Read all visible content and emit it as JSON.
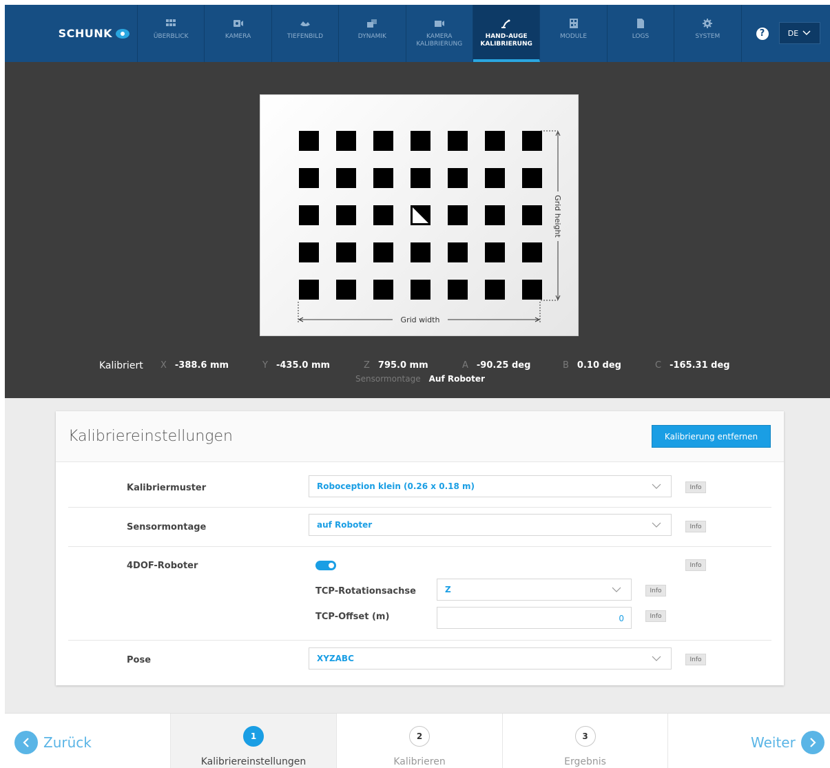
{
  "header": {
    "logo_text": "SCHUNK",
    "tabs": [
      {
        "label": "ÜBERBLICK",
        "icon": "grid-icon"
      },
      {
        "label": "KAMERA",
        "icon": "camera-icon"
      },
      {
        "label": "TIEFENBILD",
        "icon": "depth-icon"
      },
      {
        "label": "DYNAMIK",
        "icon": "dynamics-icon"
      },
      {
        "label": "KAMERA\nKALIBRIERUNG",
        "icon": "video-icon"
      },
      {
        "label": "HAND-AUGE\nKALIBRIERUNG",
        "icon": "robot-arm-icon"
      },
      {
        "label": "MODULE",
        "icon": "qr-module-icon"
      },
      {
        "label": "LOGS",
        "icon": "document-icon"
      },
      {
        "label": "SYSTEM",
        "icon": "gear-icon"
      }
    ],
    "active_tab": 5,
    "help": "?",
    "language": "DE"
  },
  "preview": {
    "grid_width_label": "Grid width",
    "grid_height_label": "Grid height",
    "calibrated_label": "Kalibriert",
    "pose": [
      {
        "key": "X",
        "value": "-388.6 mm"
      },
      {
        "key": "Y",
        "value": "-435.0 mm"
      },
      {
        "key": "Z",
        "value": "795.0 mm"
      },
      {
        "key": "A",
        "value": "-90.25 deg"
      },
      {
        "key": "B",
        "value": "0.10 deg"
      },
      {
        "key": "C",
        "value": "-165.31 deg"
      }
    ],
    "mount_key": "Sensormontage",
    "mount_value": "Auf Roboter"
  },
  "settings": {
    "title": "Kalibriereinstellungen",
    "remove_button": "Kalibrierung entfernen",
    "info_label": "Info",
    "pattern_label": "Kalibriermuster",
    "pattern_value": "Roboception klein (0.26 x 0.18 m)",
    "mount_label": "Sensormontage",
    "mount_value": "auf Roboter",
    "dof_label": "4DOF-Roboter",
    "dof_enabled": true,
    "tcp_axis_label": "TCP-Rotationsachse",
    "tcp_axis_value": "Z",
    "tcp_offset_label": "TCP-Offset (m)",
    "tcp_offset_value": "0",
    "pose_label": "Pose",
    "pose_value": "XYZABC"
  },
  "wizard": {
    "back": "Zurück",
    "next": "Weiter",
    "steps": [
      {
        "num": "1",
        "label": "Kalibriereinstellungen"
      },
      {
        "num": "2",
        "label": "Kalibrieren"
      },
      {
        "num": "3",
        "label": "Ergebnis"
      }
    ]
  },
  "colors": {
    "nav": "#164e83",
    "accent": "#1a9ee4",
    "preview_bg": "#3d3d3d"
  }
}
